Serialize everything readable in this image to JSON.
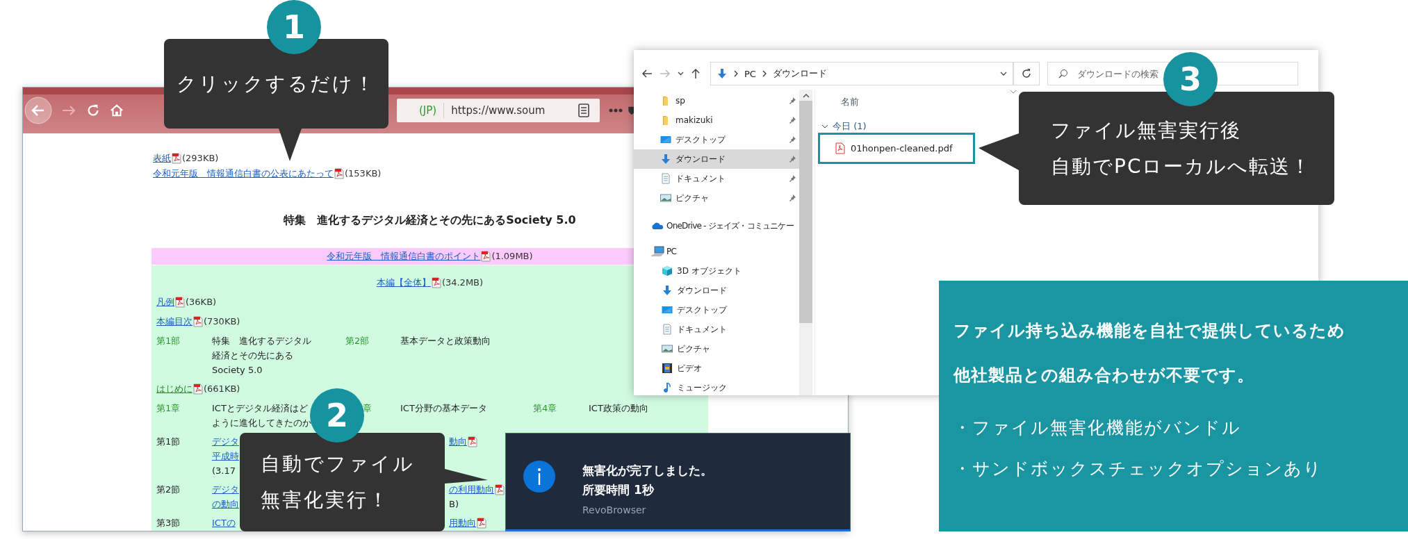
{
  "callouts": [
    {
      "number": "1",
      "lines": [
        "クリックするだけ！"
      ]
    },
    {
      "number": "2",
      "lines": [
        "自動でファイル",
        "無害化実行！"
      ]
    },
    {
      "number": "3",
      "lines": [
        "ファイル無害実行後",
        "自動でPCローカルへ転送！"
      ]
    }
  ],
  "browser": {
    "url_security": "(JP)",
    "url": "https://www.soum",
    "top_links": [
      {
        "link": "表紙",
        "size": "(293KB)",
        "visited": false
      },
      {
        "link": "令和元年版　情報通信白書の公表にあたって",
        "size": "(153KB)",
        "visited": false
      }
    ],
    "heading": "特集　進化するデジタル経済とその先にあるSociety 5.0",
    "point_link": {
      "link": "令和元年版　情報通信白書のポイント",
      "size": "(1.09MB)",
      "visited": false
    },
    "full_link": {
      "link": "本編【全体】",
      "size": "(34.2MB)",
      "visited": false
    },
    "rows": [
      {
        "kind": "link",
        "link": "凡例",
        "size": "(36KB)",
        "visited": false
      },
      {
        "kind": "link",
        "link": "本編目次",
        "size": "(730KB)",
        "visited": false
      },
      {
        "kind": "part",
        "cells": [
          {
            "lines": [
              {
                "kind": "label",
                "text": "第1部"
              }
            ]
          },
          {
            "lines": [
              {
                "kind": "text",
                "text": "特集　進化するデジタル"
              },
              {
                "kind": "text",
                "text": "経済とその先にある"
              },
              {
                "kind": "text",
                "text": "Society 5.0"
              }
            ]
          },
          {
            "lines": [
              {
                "kind": "label",
                "text": "第2部"
              }
            ]
          },
          {
            "lines": [
              {
                "kind": "text",
                "text": "基本データと政策動向"
              }
            ]
          }
        ]
      },
      {
        "kind": "link",
        "link": "はじめに",
        "size": "(661KB)",
        "visited": true
      },
      {
        "kind": "chapter",
        "cells": [
          {
            "lines": [
              {
                "kind": "label",
                "text": "第1章"
              }
            ]
          },
          {
            "lines": [
              {
                "kind": "text",
                "text": "ICTとデジタル経済はど"
              },
              {
                "kind": "text",
                "text": "ように進化してきたのか"
              }
            ]
          },
          {
            "lines": [
              {
                "kind": "label",
                "text": "章"
              }
            ]
          },
          {
            "lines": [
              {
                "kind": "text",
                "text": "ICT分野の基本データ"
              }
            ]
          },
          {
            "lines": [
              {
                "kind": "label",
                "text": "第4章"
              }
            ]
          },
          {
            "lines": [
              {
                "kind": "text",
                "text": "ICT政策の動向"
              }
            ]
          }
        ]
      },
      {
        "kind": "section",
        "cells": [
          {
            "lines": [
              {
                "kind": "text",
                "text": "第1節"
              }
            ]
          },
          {
            "lines": [
              {
                "kind": "link",
                "text": "デジタ"
              },
              {
                "kind": "link",
                "text": "平成時"
              },
              {
                "kind": "text",
                "text": "(3.17"
              }
            ]
          },
          {
            "lines": [
              {
                "kind": "link",
                "text": "動向",
                "pdf": true
              }
            ]
          }
        ]
      },
      {
        "kind": "section",
        "cells": [
          {
            "lines": [
              {
                "kind": "text",
                "text": "第2節"
              }
            ]
          },
          {
            "lines": [
              {
                "kind": "link",
                "text": "デジタ"
              },
              {
                "kind": "link",
                "text": "の動向"
              }
            ]
          },
          {
            "lines": [
              {
                "kind": "link",
                "text": "の利用動向",
                "pdf": true
              },
              {
                "kind": "text",
                "text": "B)"
              }
            ]
          }
        ]
      },
      {
        "kind": "section",
        "cells": [
          {
            "lines": [
              {
                "kind": "text",
                "text": "第3節"
              }
            ]
          },
          {
            "lines": [
              {
                "kind": "link",
                "text": "ICTの"
              }
            ]
          },
          {
            "lines": [
              {
                "kind": "link",
                "text": "用動向",
                "pdf": true
              }
            ]
          }
        ]
      }
    ]
  },
  "explorer": {
    "path": [
      "PC",
      "ダウンロード"
    ],
    "search_placeholder": "ダウンロードの検索",
    "quick_access": [
      {
        "label": "sp",
        "kind": "folder",
        "pinned": true,
        "selected": false
      },
      {
        "label": "makizuki",
        "kind": "folder",
        "pinned": true,
        "selected": false
      },
      {
        "label": "デスクトップ",
        "kind": "desktop",
        "pinned": true,
        "selected": false
      },
      {
        "label": "ダウンロード",
        "kind": "download",
        "pinned": true,
        "selected": true
      },
      {
        "label": "ドキュメント",
        "kind": "document",
        "pinned": true,
        "selected": false
      },
      {
        "label": "ピクチャ",
        "kind": "picture",
        "pinned": true,
        "selected": false
      }
    ],
    "tree": [
      {
        "label": "OneDrive - ジェイズ・コミュニケー",
        "kind": "onedrive"
      },
      {
        "label": "PC",
        "kind": "pc",
        "children": [
          {
            "label": "3D オブジェクト",
            "kind": "cube"
          },
          {
            "label": "ダウンロード",
            "kind": "download"
          },
          {
            "label": "デスクトップ",
            "kind": "desktop"
          },
          {
            "label": "ドキュメント",
            "kind": "document"
          },
          {
            "label": "ピクチャ",
            "kind": "picture"
          },
          {
            "label": "ビデオ",
            "kind": "video"
          },
          {
            "label": "ミュージック",
            "kind": "music"
          }
        ]
      }
    ],
    "column_header": "名前",
    "group": "今日 (1)",
    "files": [
      {
        "name": "01honpen-cleaned.pdf",
        "selected": true
      }
    ]
  },
  "notification": {
    "title": "無害化が完了しました。",
    "detail": "所要時間 1秒",
    "app": "RevoBrowser"
  },
  "panel": {
    "lead": [
      "ファイル持ち込み機能を自社で提供しているため",
      "他社製品との組み合わせが不要です。"
    ],
    "bullets": [
      "・ファイル無害化機能がバンドル",
      "・サンドボックスチェックオプションあり"
    ]
  }
}
